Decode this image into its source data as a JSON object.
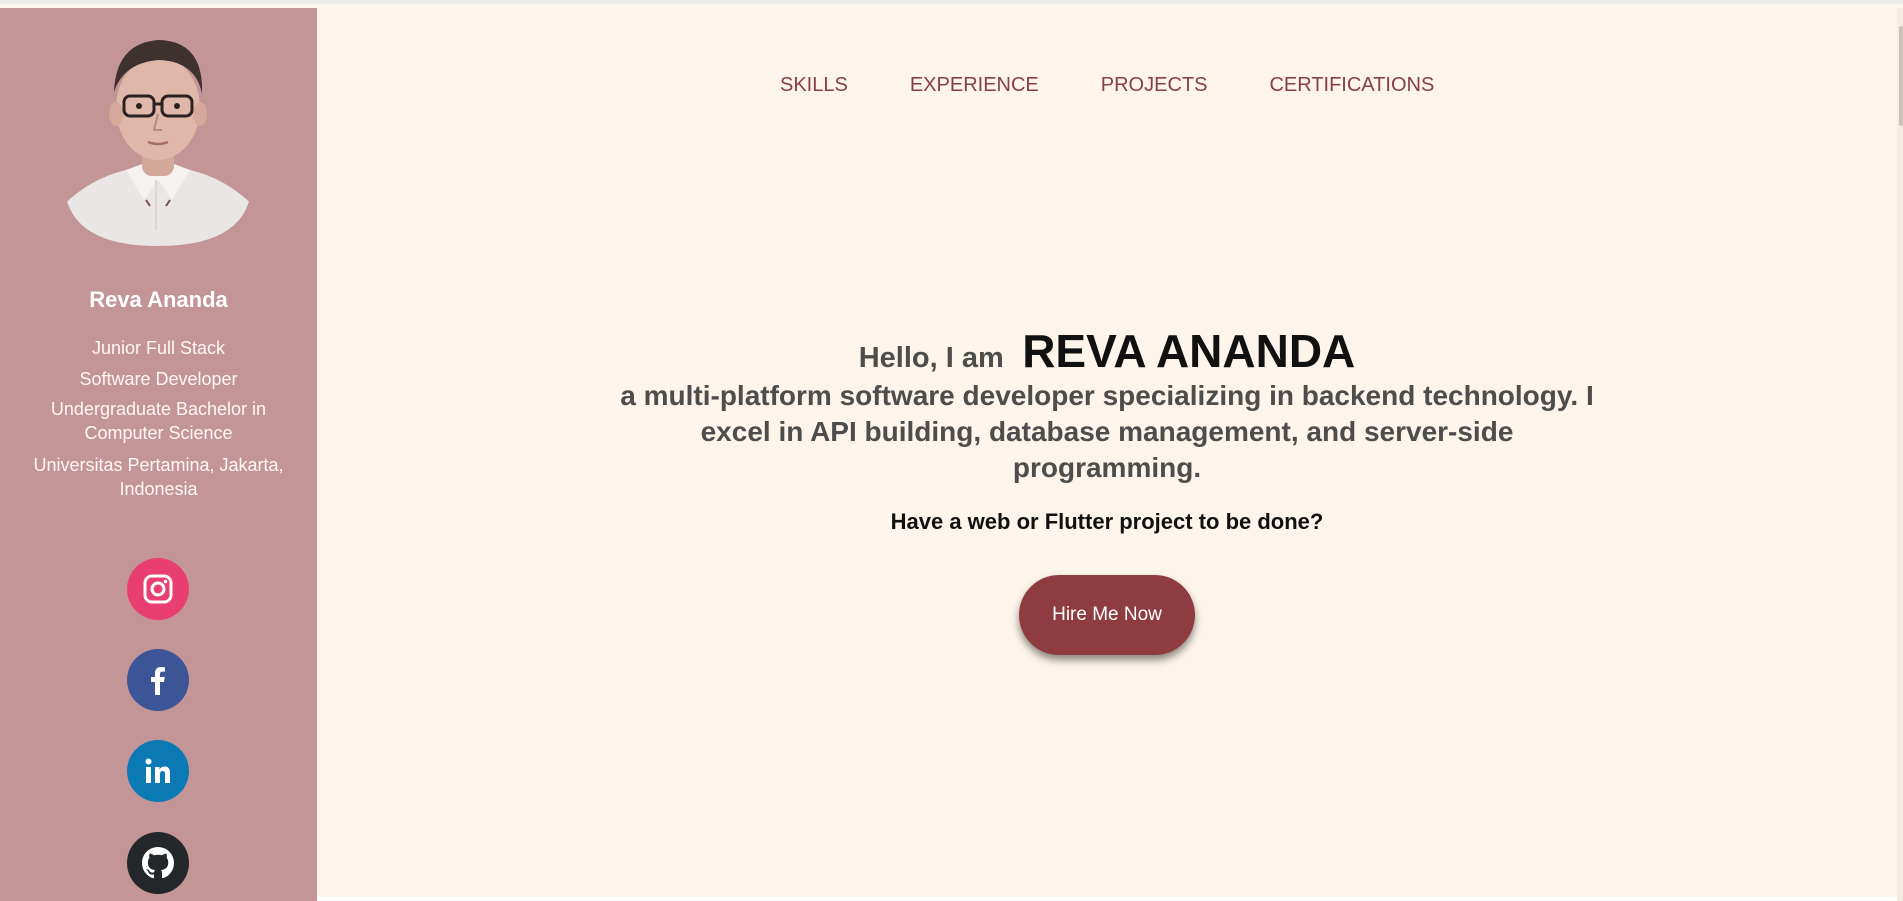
{
  "profile": {
    "name": "Reva Ananda",
    "role_line_1": "Junior Full Stack",
    "role_line_2": "Software Developer",
    "education": "Undergraduate Bachelor in Computer Science",
    "location": "Universitas Pertamina, Jakarta, Indonesia"
  },
  "social": [
    {
      "name": "instagram-icon",
      "color": "#e93e72"
    },
    {
      "name": "facebook-icon",
      "color": "#3b5597"
    },
    {
      "name": "linkedin-icon",
      "color": "#0a79b4"
    },
    {
      "name": "github-icon",
      "color": "#23272a"
    }
  ],
  "nav": {
    "items": [
      {
        "label": "SKILLS"
      },
      {
        "label": "EXPERIENCE"
      },
      {
        "label": "PROJECTS"
      },
      {
        "label": "CERTIFICATIONS"
      }
    ]
  },
  "hero": {
    "greeting": "Hello, I am",
    "name": "REVA ANANDA",
    "tagline": "a multi-platform software developer specializing in backend technology. I excel in API building, database management, and server-side programming.",
    "question": "Have a web or Flutter project to be done?",
    "button_label": "Hire Me Now"
  },
  "colors": {
    "sidebar": "#c39597",
    "page_background": "#fdf4eb",
    "accent": "#874044",
    "button": "#8e3c40"
  }
}
